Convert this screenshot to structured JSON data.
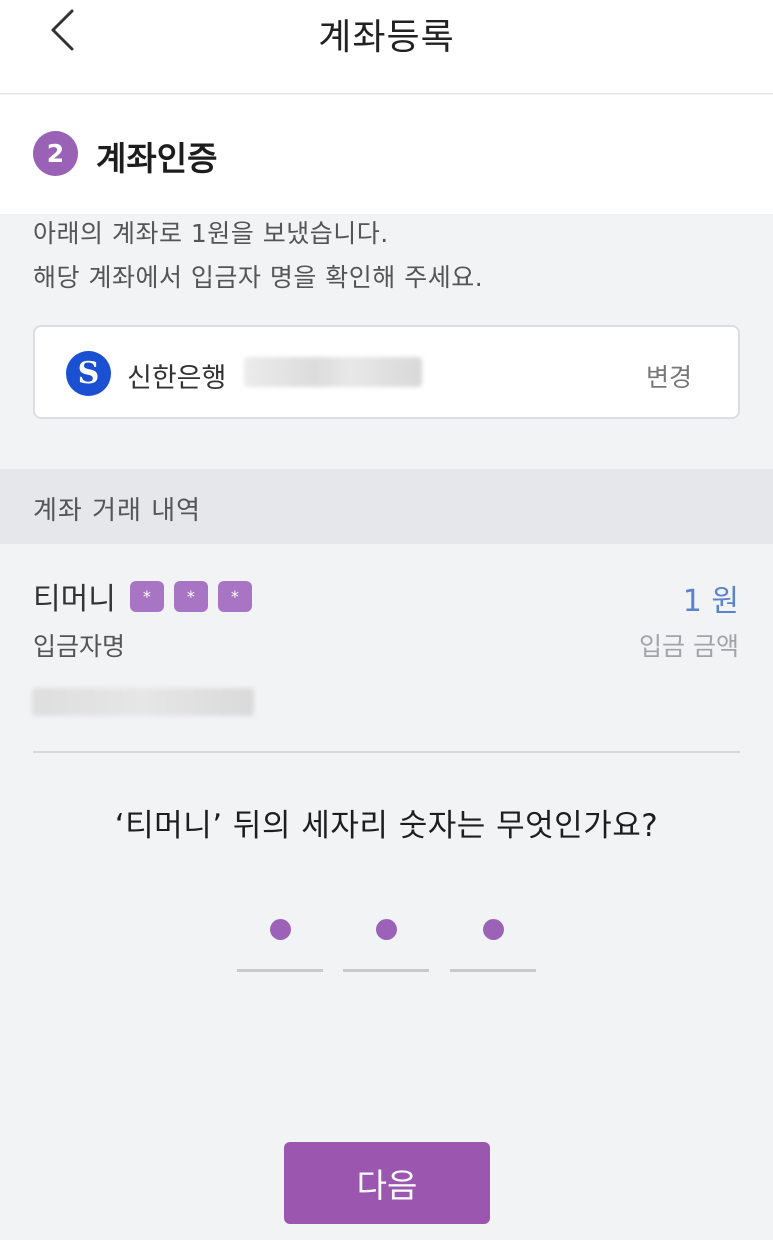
{
  "header": {
    "title": "계좌등록"
  },
  "step": {
    "number": "2",
    "title": "계좌인증"
  },
  "description": {
    "line1": "아래의 계좌로 1원을 보냈습니다.",
    "line2": "해당 계좌에서 입금자 명을 확인해 주세요."
  },
  "account": {
    "bank_name": "신한은행",
    "bank_logo_letter": "S",
    "change_label": "변경",
    "logo_color": "#1b50d2"
  },
  "history": {
    "section_label": "계좌 거래 내역",
    "depositor_prefix": "티머니",
    "masked_chars": [
      "*",
      "*",
      "*"
    ],
    "depositor_caption": "입금자명",
    "amount": "1 원",
    "amount_caption": "입금 금액"
  },
  "question": {
    "text": "‘티머니’ 뒤의 세자리 숫자는 무엇인가요?"
  },
  "pin": {
    "length": 3
  },
  "next_button": {
    "label": "다음"
  },
  "colors": {
    "accent": "#9b56b0",
    "amount_blue": "#5b83c9"
  }
}
